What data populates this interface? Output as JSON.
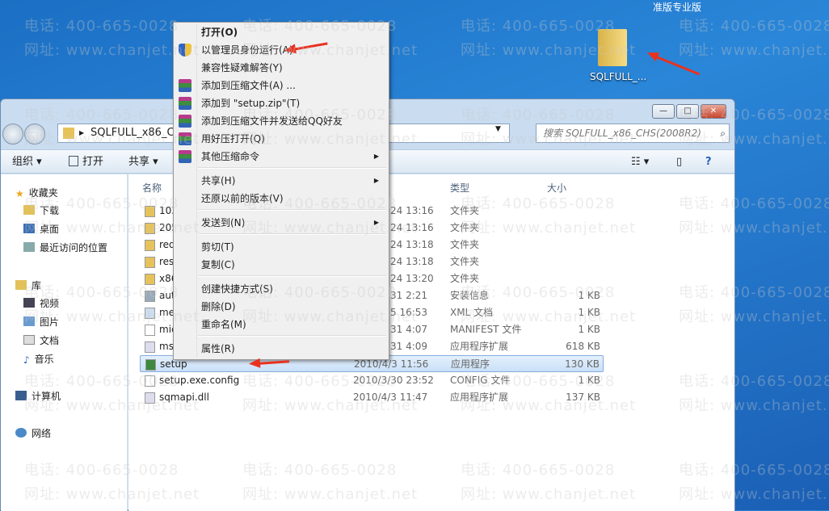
{
  "desktop": {
    "top_text": "准版专业版",
    "icon_label": "SQLFULL_..."
  },
  "watermark": {
    "phone": "电话: 400-665-0028",
    "url": "网址: www.chanjet.net"
  },
  "window": {
    "buttons": {
      "minimize": "—",
      "maximize": "□",
      "close": "✕"
    },
    "address": {
      "path": "SQLFULL_x86_CHS"
    },
    "search": {
      "placeholder": "搜索 SQLFULL_x86_CHS(2008R2)"
    },
    "toolbar": {
      "organize": "组织 ▾",
      "open": "打开",
      "share": "共享 ▾"
    },
    "sidebar": {
      "favorites": "收藏夹",
      "items": [
        {
          "label": "下载"
        },
        {
          "label": "桌面"
        },
        {
          "label": "最近访问的位置"
        }
      ],
      "library": "库",
      "lib_items": [
        {
          "label": "视频"
        },
        {
          "label": "图片"
        },
        {
          "label": "文档"
        },
        {
          "label": "音乐"
        }
      ],
      "computer": "计算机",
      "network": "网络"
    },
    "columns": {
      "name": "名称",
      "type": "类型",
      "size": "大小"
    },
    "files": [
      {
        "name": "103",
        "date": "24 13:16",
        "type": "文件夹",
        "size": "",
        "icon": "folder"
      },
      {
        "name": "205",
        "date": "24 13:16",
        "type": "文件夹",
        "size": "",
        "icon": "folder"
      },
      {
        "name": "red",
        "date": "24 13:18",
        "type": "文件夹",
        "size": "",
        "icon": "folder"
      },
      {
        "name": "res",
        "date": "24 13:18",
        "type": "文件夹",
        "size": "",
        "icon": "folder"
      },
      {
        "name": "x86",
        "date": "24 13:20",
        "type": "文件夹",
        "size": "",
        "icon": "folder"
      },
      {
        "name": "aut",
        "date": "31 2:21",
        "type": "安装信息",
        "size": "1 KB",
        "icon": "settings-file"
      },
      {
        "name": "me",
        "date": "5 16:53",
        "type": "XML 文档",
        "size": "1 KB",
        "icon": "xml-file"
      },
      {
        "name": "mic",
        "date": "31 4:07",
        "type": "MANIFEST 文件",
        "size": "1 KB",
        "icon": "file"
      },
      {
        "name": "ms",
        "date": "31 4:09",
        "type": "应用程序扩展",
        "size": "618 KB",
        "icon": "dll-file"
      },
      {
        "name": "setup",
        "date": "2010/4/3 11:56",
        "type": "应用程序",
        "size": "130 KB",
        "icon": "exe-file",
        "selected": true
      },
      {
        "name": "setup.exe.config",
        "date": "2010/3/30 23:52",
        "type": "CONFIG 文件",
        "size": "1 KB",
        "icon": "file"
      },
      {
        "name": "sqmapi.dll",
        "date": "2010/4/3 11:47",
        "type": "应用程序扩展",
        "size": "137 KB",
        "icon": "dll-file"
      }
    ]
  },
  "context_menu": {
    "items": [
      {
        "label": "打开(O)",
        "bold": true
      },
      {
        "label": "以管理员身份运行(A)",
        "icon": "shield"
      },
      {
        "label": "兼容性疑难解答(Y)"
      },
      {
        "label": "添加到压缩文件(A) ...",
        "icon": "rar"
      },
      {
        "label": "添加到 \"setup.zip\"(T)",
        "icon": "rar"
      },
      {
        "label": "添加到压缩文件并发送给QQ好友",
        "icon": "rar"
      },
      {
        "label": "用好压打开(Q)",
        "icon": "rar"
      },
      {
        "label": "其他压缩命令",
        "icon": "rar",
        "submenu": true
      },
      {
        "label": "共享(H)",
        "submenu": true
      },
      {
        "label": "还原以前的版本(V)"
      },
      {
        "label": "发送到(N)",
        "submenu": true
      },
      {
        "label": "剪切(T)"
      },
      {
        "label": "复制(C)"
      },
      {
        "label": "创建快捷方式(S)"
      },
      {
        "label": "删除(D)"
      },
      {
        "label": "重命名(M)"
      },
      {
        "label": "属性(R)"
      }
    ]
  },
  "colors": {
    "desktop": "#2a86d8",
    "selection": "#c9e0f8",
    "arrow": "#e8321f"
  }
}
